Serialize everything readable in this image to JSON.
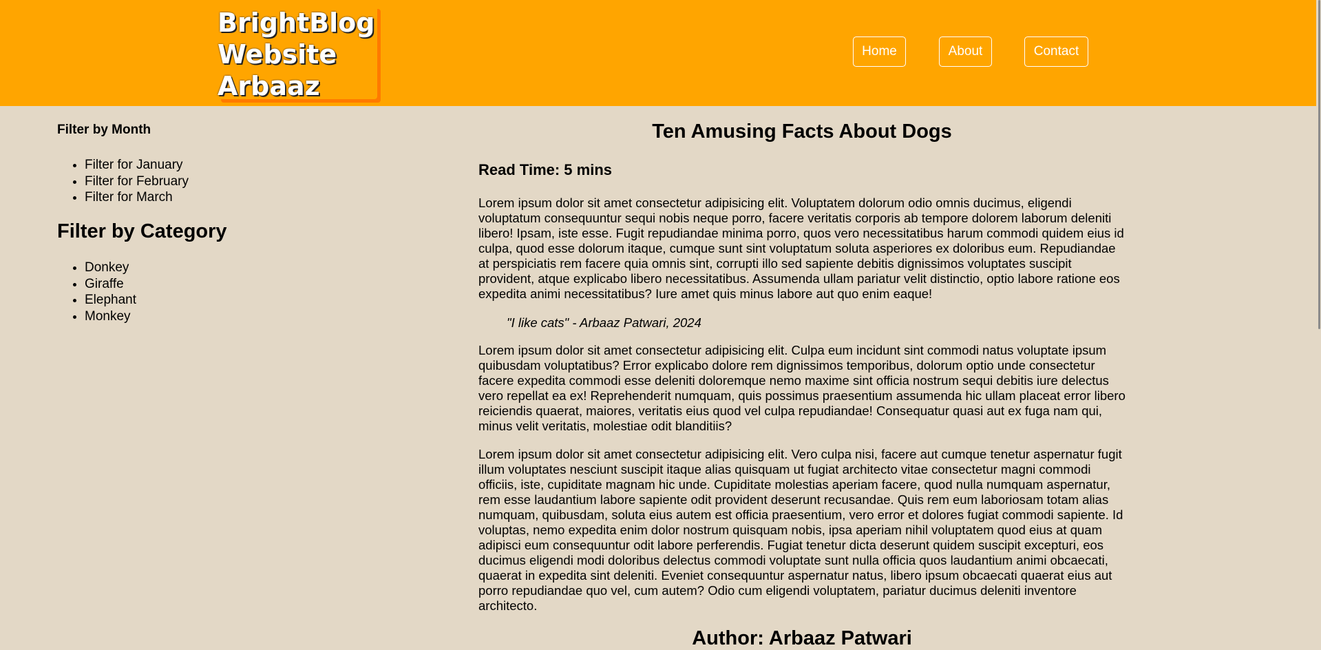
{
  "header": {
    "logo_lines": [
      "BrightBlog",
      "Website",
      "Arbaaz"
    ],
    "nav": {
      "home": "Home",
      "about": "About",
      "contact": "Contact"
    }
  },
  "sidebar": {
    "month_heading": "Filter by Month",
    "months": [
      "Filter for January",
      "Filter for February",
      "Filter for March"
    ],
    "category_heading": "Filter by Category",
    "categories": [
      "Donkey",
      "Giraffe",
      "Elephant",
      "Monkey"
    ]
  },
  "article": {
    "title": "Ten Amusing Facts About Dogs",
    "read_time": "Read Time: 5 mins",
    "paragraph_1": "Lorem ipsum dolor sit amet consectetur adipisicing elit. Voluptatem dolorum odio omnis ducimus, eligendi voluptatum consequuntur sequi nobis neque porro, facere veritatis corporis ab tempore dolorem laborum deleniti libero! Ipsam, iste esse. Fugit repudiandae minima porro, quos vero necessitatibus harum commodi quidem eius id culpa, quod esse dolorum itaque, cumque sunt sint voluptatum soluta asperiores ex doloribus eum. Repudiandae at perspiciatis rem facere quia omnis sint, corrupti illo sed sapiente debitis dignissimos voluptates suscipit provident, atque explicabo libero necessitatibus. Assumenda ullam pariatur velit distinctio, optio labore ratione eos expedita animi necessitatibus? Iure amet quis minus labore aut quo enim eaque!",
    "quote": "\"I like cats\" - Arbaaz Patwari, 2024",
    "paragraph_2": "Lorem ipsum dolor sit amet consectetur adipisicing elit. Culpa eum incidunt sint commodi natus voluptate ipsum quibusdam voluptatibus? Error explicabo dolore rem dignissimos temporibus, dolorum optio unde consectetur facere expedita commodi esse deleniti doloremque nemo maxime sint officia nostrum sequi debitis iure delectus vero repellat ea ex! Reprehenderit numquam, quis possimus praesentium assumenda hic ullam placeat error libero reiciendis quaerat, maiores, veritatis eius quod vel culpa repudiandae! Consequatur quasi aut ex fuga nam qui, minus velit veritatis, molestiae odit blanditiis?",
    "paragraph_3": "Lorem ipsum dolor sit amet consectetur adipisicing elit. Vero culpa nisi, facere aut cumque tenetur aspernatur fugit illum voluptates nesciunt suscipit itaque alias quisquam ut fugiat architecto vitae consectetur magni commodi officiis, iste, cupiditate magnam hic unde. Cupiditate molestias aperiam facere, quod nulla numquam aspernatur, rem esse laudantium labore sapiente odit provident deserunt recusandae. Quis rem eum laboriosam totam alias numquam, quibusdam, soluta eius autem est officia praesentium, vero error et dolores fugiat commodi sapiente. Id voluptas, nemo expedita enim dolor nostrum quisquam nobis, ipsa aperiam nihil voluptatem quod eius at quam adipisci eum consequuntur odit labore perferendis. Fugiat tenetur dicta deserunt quidem suscipit excepturi, eos ducimus eligendi modi doloribus delectus commodi voluptate sunt nulla officia quos laudantium animi obcaecati, quaerat in expedita sint deleniti. Eveniet consequuntur aspernatur natus, libero ipsum obcaecati quaerat eius aut porro repudiandae quo vel, cum autem? Odio cum eligendi voluptatem, pariatur ducimus deleniti inventore architecto.",
    "author": "Author: Arbaaz Patwari"
  },
  "colors": {
    "header_bg": "#ffa500",
    "logo_shadow": "#ff7a00",
    "page_bg": "#e3d8c6"
  }
}
